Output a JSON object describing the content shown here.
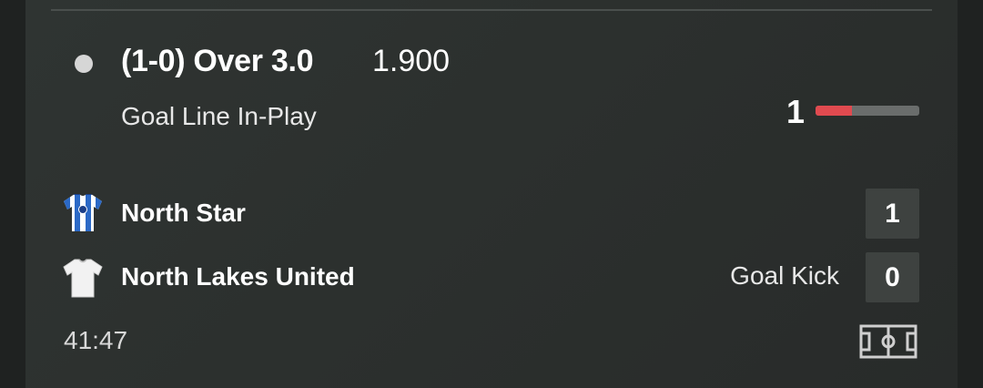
{
  "bet": {
    "selection": "(1-0) Over 3.0",
    "odds": "1.900",
    "market": "Goal Line In-Play",
    "stake_count": "1",
    "progress_fraction": 0.35,
    "progress_color": "#e04a4f"
  },
  "match": {
    "home": {
      "name": "North Star",
      "score": "1",
      "kit_icon": "blue-white-striped-shirt-icon"
    },
    "away": {
      "name": "North Lakes United",
      "score": "0",
      "kit_icon": "white-shirt-icon",
      "event": "Goal Kick"
    },
    "clock": "41:47",
    "pitch_icon": "football-pitch-icon"
  }
}
